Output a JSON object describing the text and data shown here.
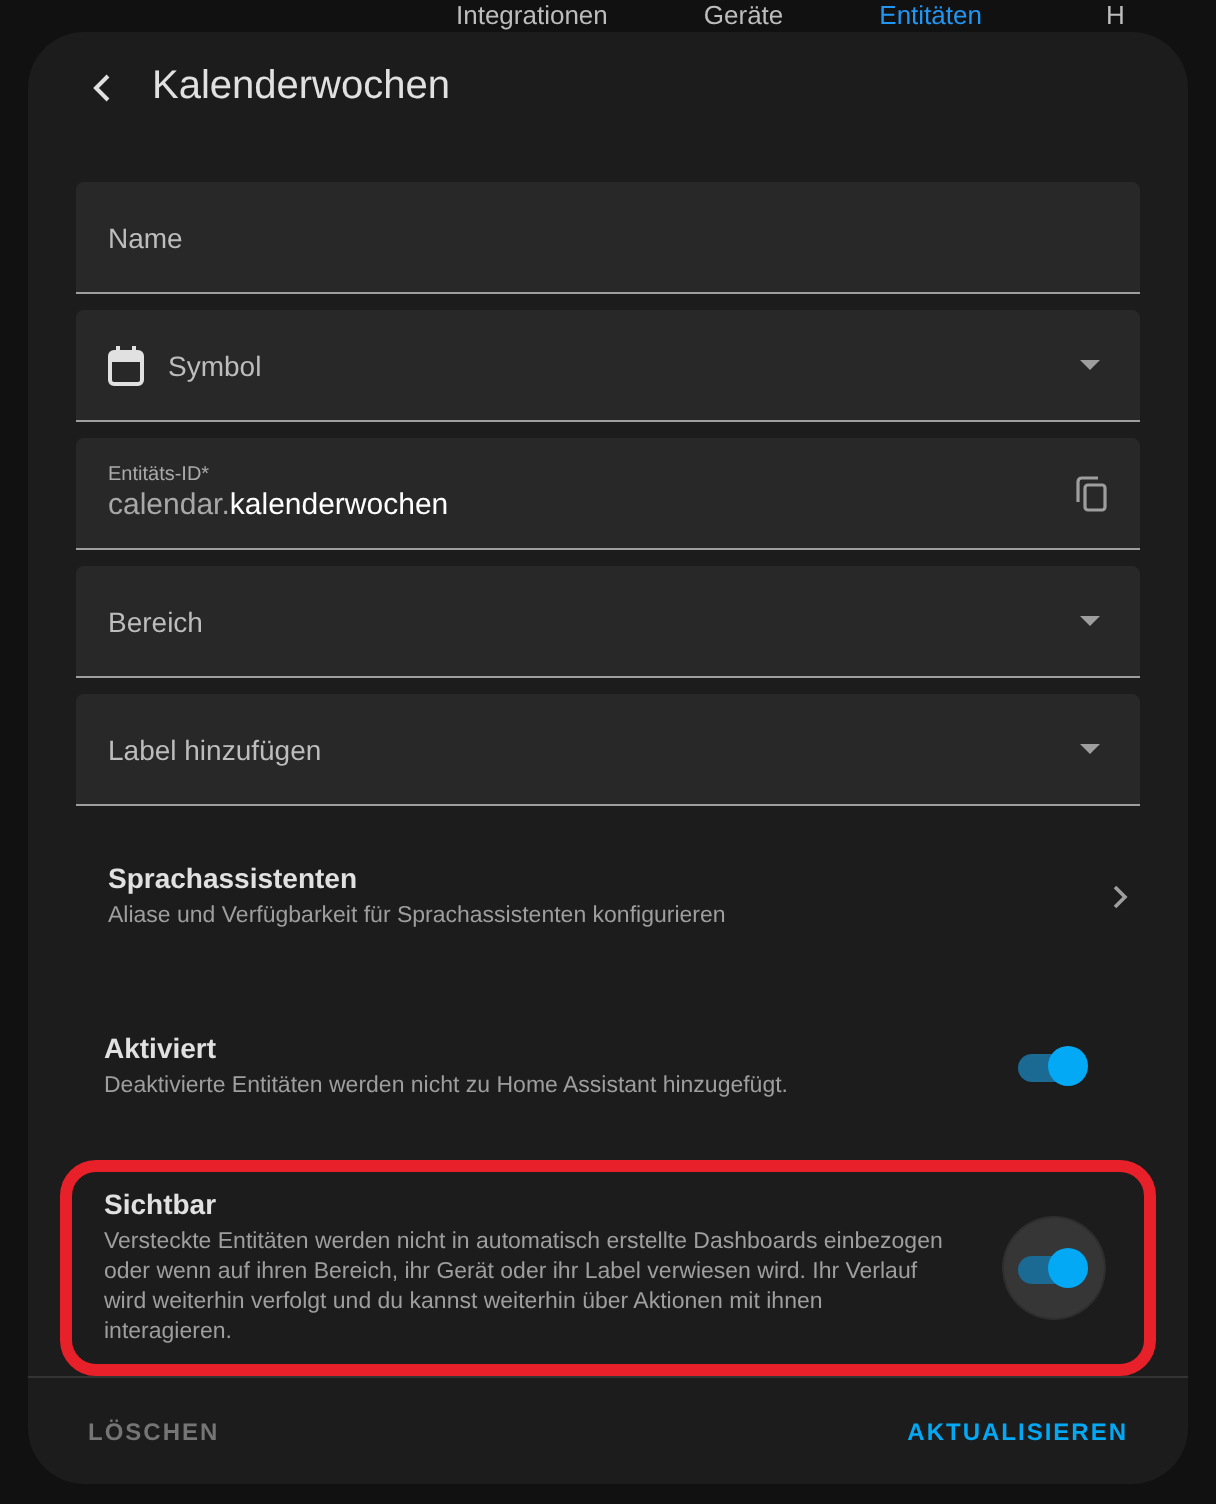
{
  "background_tabs": [
    {
      "label": "Integrationen",
      "selected": false
    },
    {
      "label": "Geräte",
      "selected": false
    },
    {
      "label": "Entitäten",
      "selected": true
    },
    {
      "label": "H",
      "selected": false
    }
  ],
  "dialog": {
    "title": "Kalenderwochen",
    "fields": [
      {
        "kind": "text",
        "label": "Name"
      },
      {
        "kind": "icon-select",
        "label": "Symbol"
      },
      {
        "kind": "entity-id",
        "label": "Entitäts-ID*",
        "prefix": "calendar.",
        "value": "kalenderwochen"
      },
      {
        "kind": "select",
        "label": "Bereich"
      },
      {
        "kind": "select",
        "label": "Label hinzufügen"
      }
    ],
    "link_row": {
      "title": "Sprachassistenten",
      "description": "Aliase und Verfügbarkeit für Sprachassistenten konfigurieren"
    },
    "toggles": [
      {
        "title": "Aktiviert",
        "description": "Deaktivierte Entitäten werden nicht zu Home Assistant hinzugefügt.",
        "on": true,
        "focused": false,
        "highlighted": false
      },
      {
        "title": "Sichtbar",
        "description": "Versteckte Entitäten werden nicht in automatisch erstellte Dashboards einbezogen oder wenn auf ihren Bereich, ihr Gerät oder ihr Label verwiesen wird. Ihr Verlauf wird weiterhin verfolgt und du kannst weiterhin über Aktionen mit ihnen interagieren.",
        "on": true,
        "focused": true,
        "highlighted": true
      }
    ],
    "actions": [
      {
        "kind": "secondary",
        "label": "LÖSCHEN"
      },
      {
        "kind": "primary",
        "label": "AKTUALISIEREN"
      }
    ]
  }
}
